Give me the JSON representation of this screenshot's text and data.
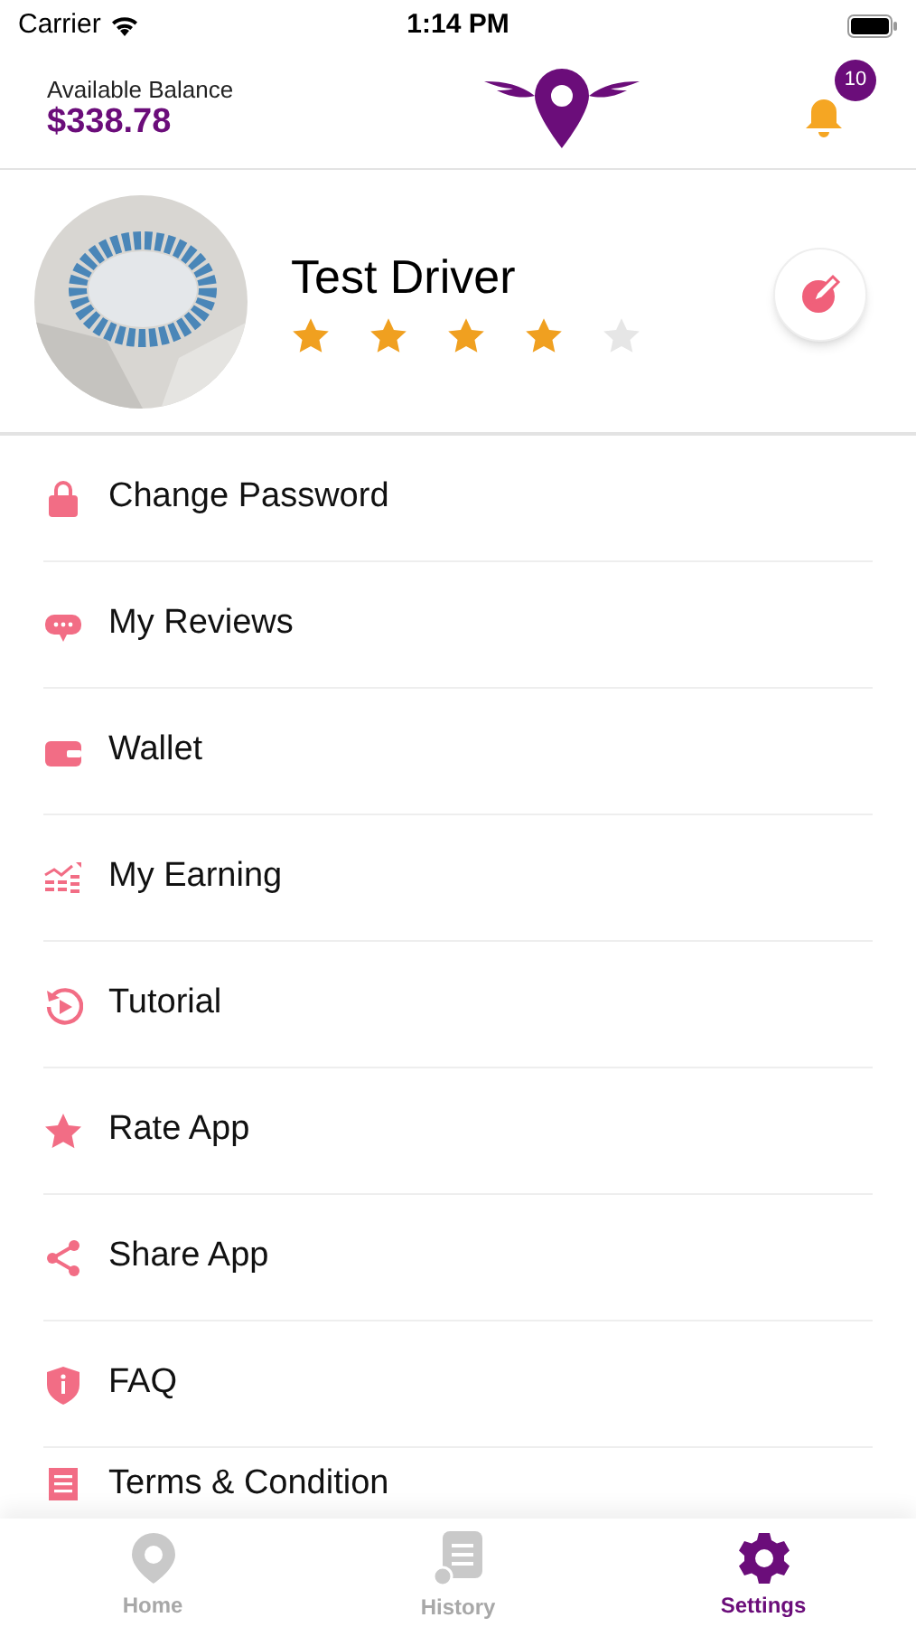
{
  "status_bar": {
    "carrier": "Carrier",
    "time": "1:14 PM"
  },
  "header": {
    "balance_label": "Available Balance",
    "balance": "$338.78",
    "notification_count": "10"
  },
  "profile": {
    "name": "Test Driver",
    "stars": 4
  },
  "menu": [
    {
      "kind": "lock",
      "label": "Change Password"
    },
    {
      "kind": "chat",
      "label": "My Reviews"
    },
    {
      "kind": "wallet",
      "label": "Wallet"
    },
    {
      "kind": "chart",
      "label": "My Earning"
    },
    {
      "kind": "play",
      "label": "Tutorial"
    },
    {
      "kind": "star",
      "label": "Rate App"
    },
    {
      "kind": "share",
      "label": "Share App"
    },
    {
      "kind": "shield",
      "label": "FAQ"
    },
    {
      "kind": "doc",
      "label": "Terms & Condition"
    }
  ],
  "tab_bar": [
    {
      "kind": "home",
      "label": "Home",
      "selected": false
    },
    {
      "kind": "history",
      "label": "History",
      "selected": false
    },
    {
      "kind": "settings",
      "label": "Settings",
      "selected": true
    }
  ]
}
